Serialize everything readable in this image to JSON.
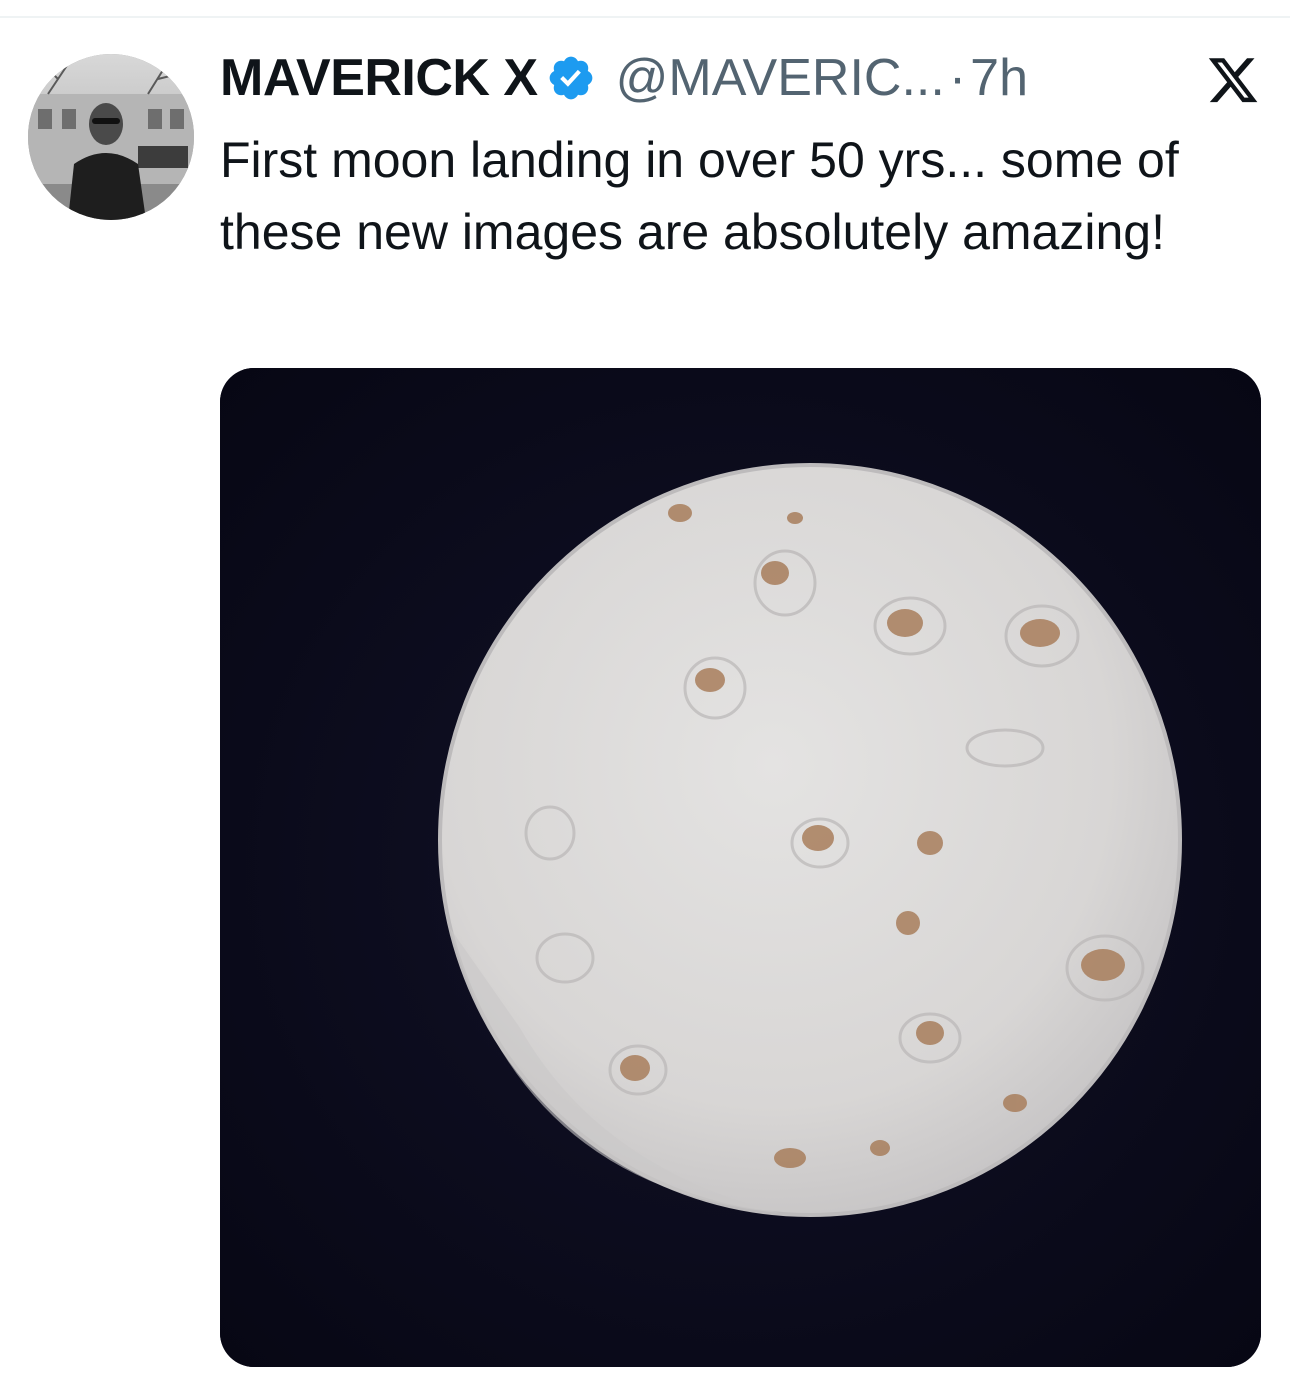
{
  "tweet": {
    "display_name": "MAVERICK X",
    "handle": "@MAVERIC...",
    "separator": "·",
    "time": "7h",
    "text": "First moon landing in over 50 yrs... some of these new images are absolutely amazing!"
  },
  "icons": {
    "verified": "verified-badge-icon",
    "platform": "x-logo-icon",
    "avatar": "profile-avatar"
  },
  "colors": {
    "verified_blue": "#1d9bf0",
    "text_primary": "#0f1419",
    "text_secondary": "#536471",
    "media_background": "#0b0b1c",
    "tortilla": "#dcdad8",
    "toasted_spot": "#a87e5c"
  }
}
